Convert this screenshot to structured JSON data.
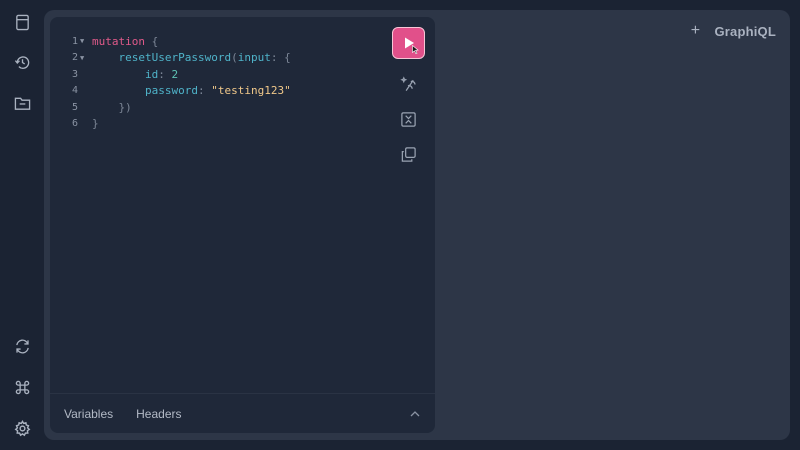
{
  "sidebar": {
    "top_items": [
      {
        "name": "docs-icon"
      },
      {
        "name": "history-icon"
      },
      {
        "name": "explorer-folder-icon"
      }
    ],
    "bottom_items": [
      {
        "name": "refetch-schema-icon"
      },
      {
        "name": "keyboard-shortcuts-icon"
      },
      {
        "name": "settings-gear-icon"
      }
    ]
  },
  "header": {
    "add_tab_label": "+",
    "logo": "GraphiQL"
  },
  "editor": {
    "lines": [
      {
        "num": "1",
        "fold": true,
        "tokens": [
          {
            "t": "mutation",
            "c": "kw"
          },
          {
            "t": " {",
            "c": "punc"
          }
        ]
      },
      {
        "num": "2",
        "fold": true,
        "tokens": [
          {
            "t": "    ",
            "c": "punc"
          },
          {
            "t": "resetUserPassword",
            "c": "fn"
          },
          {
            "t": "(",
            "c": "punc"
          },
          {
            "t": "input",
            "c": "arg"
          },
          {
            "t": ": {",
            "c": "punc"
          }
        ]
      },
      {
        "num": "3",
        "fold": false,
        "tokens": [
          {
            "t": "        ",
            "c": "punc"
          },
          {
            "t": "id",
            "c": "arg"
          },
          {
            "t": ": ",
            "c": "punc"
          },
          {
            "t": "2",
            "c": "num"
          }
        ]
      },
      {
        "num": "4",
        "fold": false,
        "tokens": [
          {
            "t": "        ",
            "c": "punc"
          },
          {
            "t": "password",
            "c": "arg"
          },
          {
            "t": ": ",
            "c": "punc"
          },
          {
            "t": "\"testing123\"",
            "c": "str"
          }
        ]
      },
      {
        "num": "5",
        "fold": false,
        "tokens": [
          {
            "t": "    ",
            "c": "punc"
          },
          {
            "t": "})",
            "c": "punc"
          }
        ]
      },
      {
        "num": "6",
        "fold": false,
        "tokens": [
          {
            "t": "}",
            "c": "punc"
          }
        ]
      }
    ]
  },
  "toolbar": {
    "run": "execute-query-button",
    "tools": [
      "prettify-button",
      "merge-fragments-button",
      "copy-query-button"
    ]
  },
  "footer": {
    "variables_tab": "Variables",
    "headers_tab": "Headers"
  },
  "colors": {
    "background": "#1b2333",
    "panel": "#2d3647",
    "editor": "#1f2839",
    "accent": "#e1508a"
  }
}
